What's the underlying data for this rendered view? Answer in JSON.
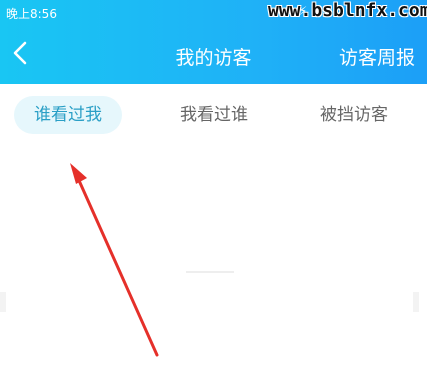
{
  "status_bar": {
    "time": "晚上8:56",
    "icons": "◦ ✉ ⚡ ▮"
  },
  "watermark": "www.bsblnfx.com",
  "header": {
    "back_icon": "chevron-left-icon",
    "title": "我的访客",
    "weekly_report": "访客周报"
  },
  "tabs": [
    {
      "label": "谁看过我",
      "active": true
    },
    {
      "label": "我看过谁",
      "active": false
    },
    {
      "label": "被挡访客",
      "active": false
    }
  ],
  "colors": {
    "header_start": "#19c6f3",
    "header_end": "#1c9ff7",
    "active_tab_bg": "#e6f7fc",
    "active_tab_text": "#2a9fc6",
    "annotation_arrow": "#e5302a"
  }
}
